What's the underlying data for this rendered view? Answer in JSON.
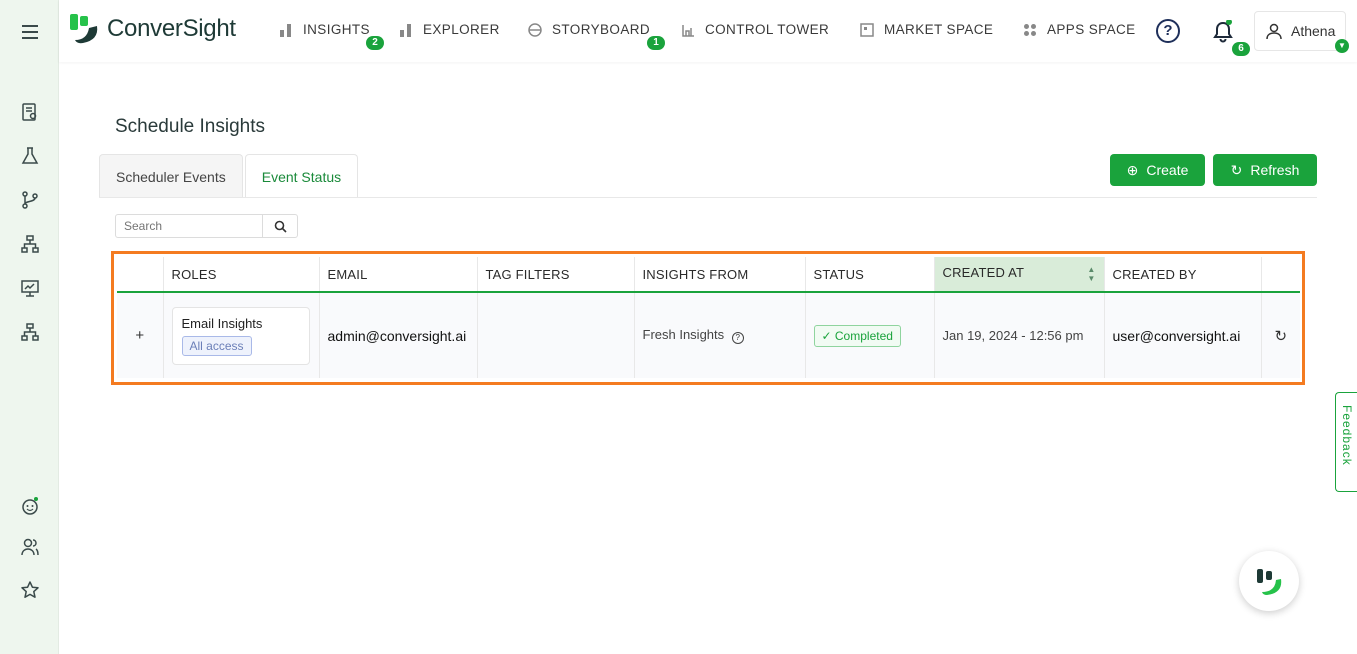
{
  "sidebar": {
    "items": [
      {
        "icon": "menu-icon"
      },
      {
        "icon": "report-search-icon"
      },
      {
        "icon": "flask-icon"
      },
      {
        "icon": "branch-icon"
      },
      {
        "icon": "hierarchy-icon"
      },
      {
        "icon": "presentation-chart-icon"
      },
      {
        "icon": "sitemap-icon"
      },
      {
        "icon": "bot-face-icon"
      },
      {
        "icon": "users-icon"
      },
      {
        "icon": "star-icon"
      }
    ]
  },
  "header": {
    "logo_text": "ConverSight",
    "nav": [
      {
        "label": "INSIGHTS",
        "badge": "2",
        "icon": "bar-chart-icon"
      },
      {
        "label": "EXPLORER",
        "badge": "",
        "icon": "bar-chart-icon"
      },
      {
        "label": "STORYBOARD",
        "badge": "1",
        "icon": "palette-icon"
      },
      {
        "label": "CONTROL TOWER",
        "badge": "",
        "icon": "tower-icon"
      },
      {
        "label": "MARKET SPACE",
        "badge": "",
        "icon": "market-icon"
      },
      {
        "label": "APPS SPACE",
        "badge": "",
        "icon": "apps-grid-icon"
      }
    ],
    "help": "?",
    "notifications_count": "6",
    "user_name": "Athena"
  },
  "page": {
    "title": "Schedule Insights",
    "tabs": [
      {
        "label": "Scheduler Events",
        "active": false
      },
      {
        "label": "Event Status",
        "active": true
      }
    ],
    "create_label": "Create",
    "refresh_label": "Refresh",
    "search_placeholder": "Search"
  },
  "table": {
    "columns": [
      "",
      "ROLES",
      "EMAIL",
      "TAG FILTERS",
      "INSIGHTS FROM",
      "STATUS",
      "CREATED AT",
      "CREATED BY",
      ""
    ],
    "sorted_column": "CREATED AT",
    "rows": [
      {
        "expand": "+",
        "role_name": "Email Insights",
        "role_tag": "All access",
        "email": "admin@conversight.ai",
        "tag_filters": "",
        "insights_from": "Fresh Insights",
        "status": "Completed",
        "created_at": "Jan 19, 2024 - 12:56 pm",
        "created_by": "user@conversight.ai"
      }
    ]
  },
  "feedback_label": "Feedback",
  "colors": {
    "accent": "#1aa33c",
    "highlight": "#f47b20",
    "sidebar_bg": "#eef6ee"
  }
}
